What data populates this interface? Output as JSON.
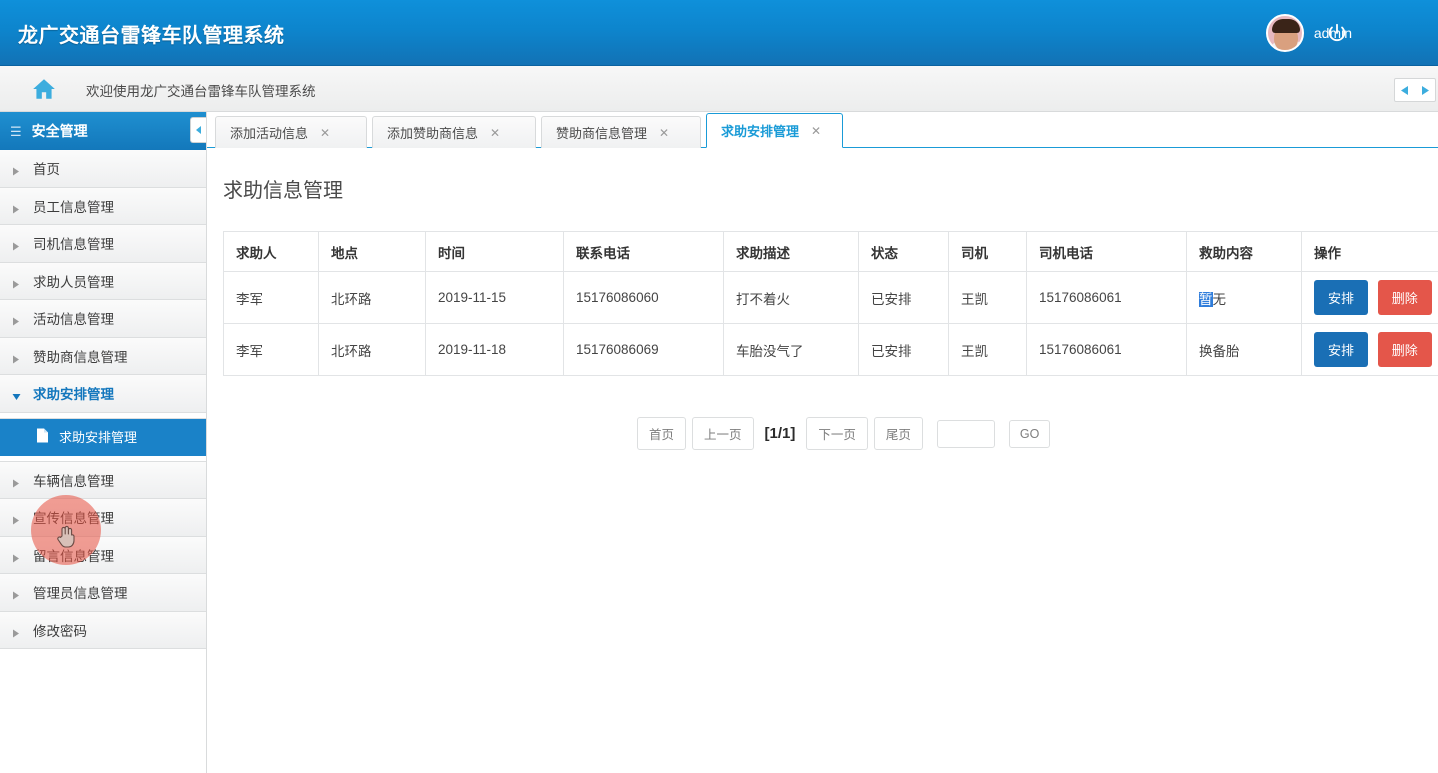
{
  "header": {
    "app_title": "龙广交通台雷锋车队管理系统",
    "username": "admin",
    "avatar_icon": "user-avatar",
    "power_icon": "power-off-icon"
  },
  "welcome_bar": {
    "home_icon": "home-icon",
    "text": "欢迎使用龙广交通台雷锋车队管理系统",
    "prev_icon": "chevron-left-icon",
    "next_icon": "chevron-right-icon"
  },
  "sidebar": {
    "header_label": "安全管理",
    "header_icon": "menu-list-icon",
    "collapse_icon": "chevron-left-icon",
    "items": [
      {
        "label": "首页",
        "icon": "caret-right-icon",
        "expanded": false
      },
      {
        "label": "员工信息管理",
        "icon": "caret-right-icon",
        "expanded": false
      },
      {
        "label": "司机信息管理",
        "icon": "caret-right-icon",
        "expanded": false
      },
      {
        "label": "求助人员管理",
        "icon": "caret-right-icon",
        "expanded": false
      },
      {
        "label": "活动信息管理",
        "icon": "caret-right-icon",
        "expanded": false
      },
      {
        "label": "赞助商信息管理",
        "icon": "caret-right-icon",
        "expanded": false
      },
      {
        "label": "求助安排管理",
        "icon": "caret-down-icon",
        "expanded": true
      }
    ],
    "sub_item": {
      "label": "求助安排管理",
      "icon": "document-icon"
    },
    "items_after": [
      {
        "label": "车辆信息管理",
        "icon": "caret-right-icon",
        "expanded": false
      },
      {
        "label": "宣传信息管理",
        "icon": "caret-right-icon",
        "expanded": false
      },
      {
        "label": "留言信息管理",
        "icon": "caret-right-icon",
        "expanded": false
      },
      {
        "label": "管理员信息管理",
        "icon": "caret-right-icon",
        "expanded": false
      },
      {
        "label": "修改密码",
        "icon": "caret-right-icon",
        "expanded": false
      }
    ]
  },
  "tabs": [
    {
      "label": "添加活动信息",
      "close_icon": "close-icon",
      "active": false
    },
    {
      "label": "添加赞助商信息",
      "close_icon": "close-icon",
      "active": false
    },
    {
      "label": "赞助商信息管理",
      "close_icon": "close-icon",
      "active": false
    },
    {
      "label": "求助安排管理",
      "close_icon": "close-icon",
      "active": true
    }
  ],
  "main": {
    "page_title": "求助信息管理",
    "table": {
      "columns": [
        "求助人",
        "地点",
        "时间",
        "联系电话",
        "求助描述",
        "状态",
        "司机",
        "司机电话",
        "救助内容",
        "操作"
      ],
      "rows": [
        {
          "求助人": "李军",
          "地点": "北环路",
          "时间": "2019-11-15",
          "联系电话": "15176086060",
          "求助描述": "打不着火",
          "状态": "已安排",
          "司机": "王凯",
          "司机电话": "15176086061",
          "救助内容": "暂无",
          "救助内容_selected": "暂",
          "救助内容_rest": "无",
          "assign_label": "安排",
          "delete_label": "删除"
        },
        {
          "求助人": "李军",
          "地点": "北环路",
          "时间": "2019-11-18",
          "联系电话": "15176086069",
          "求助描述": "车胎没气了",
          "状态": "已安排",
          "司机": "王凯",
          "司机电话": "15176086061",
          "救助内容": "换备胎",
          "救助内容_selected": "",
          "救助内容_rest": "换备胎",
          "assign_label": "安排",
          "delete_label": "删除"
        }
      ]
    },
    "pagination": {
      "first": "首页",
      "prev": "上一页",
      "indicator": "[1/1]",
      "next": "下一页",
      "last": "尾页",
      "jump_value": "",
      "go": "GO"
    }
  },
  "colors": {
    "brand_blue": "#0f90da",
    "header_dark_blue": "#1272b5",
    "active_tab_blue": "#1a9bd7",
    "sidebar_active": "#1a82c8",
    "assign_button": "#1a6fb5",
    "delete_button": "#e4564a",
    "selection_blue": "#2f7ddb",
    "click_indicator": "#e84e3e"
  }
}
